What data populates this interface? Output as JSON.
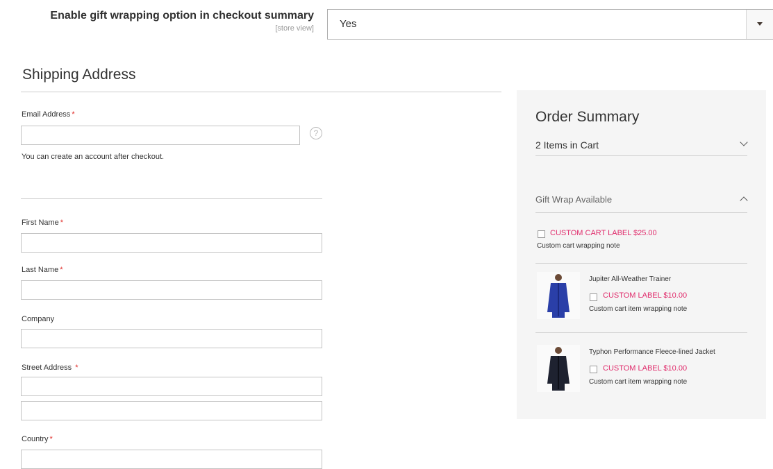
{
  "config": {
    "label": "Enable gift wrapping option in checkout summary",
    "scope": "[store view]",
    "selected_value": "Yes"
  },
  "shipping": {
    "title": "Shipping Address",
    "email_label": "Email Address",
    "required_mark": "*",
    "email_note": "You can create an account after checkout.",
    "first_name_label": "First Name",
    "last_name_label": "Last Name",
    "company_label": "Company",
    "street_label": "Street Address",
    "country_label": "Country",
    "help_glyph": "?"
  },
  "summary": {
    "title": "Order Summary",
    "items_in_cart": "2 Items in Cart",
    "gift_section_title": "Gift Wrap Available",
    "cart_wrap": {
      "label": "CUSTOM CART LABEL $25.00",
      "note": "Custom cart wrapping note"
    },
    "products": [
      {
        "name": "Jupiter All-Weather Trainer",
        "wrap_label": "CUSTOM LABEL $10.00",
        "wrap_note": "Custom cart item wrapping note",
        "jacket_color": "#2a3fa8"
      },
      {
        "name": "Typhon Performance Fleece-lined Jacket",
        "wrap_label": "CUSTOM LABEL $10.00",
        "wrap_note": "Custom cart item wrapping note",
        "jacket_color": "#1e2230"
      }
    ]
  },
  "colors": {
    "accent_pink": "#e02b6b",
    "required_red": "#e02b27",
    "summary_bg": "#f5f5f5"
  }
}
